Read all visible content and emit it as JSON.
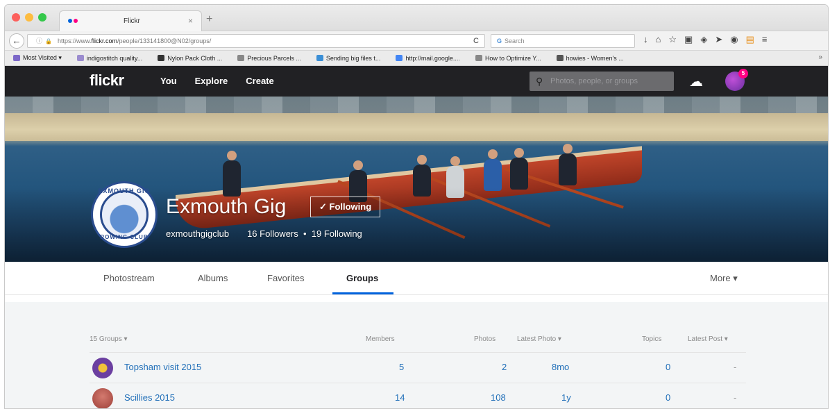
{
  "browser": {
    "tab_title": "Flickr",
    "tab_close": "×",
    "new_tab": "+",
    "back_icon": "←",
    "url_info_icon": "ⓘ",
    "url_lock_icon": "🔒",
    "url_prefix": "https://www.",
    "url_host": "flickr.com",
    "url_path": "/people/133141800@N02/groups/",
    "reload_icon": "C",
    "search_placeholder": "Search",
    "search_g": "G",
    "toolbar_icons": [
      "↓",
      "⌂",
      "☆",
      "▣",
      "◈",
      "➤",
      "◉",
      "▤",
      "≡"
    ],
    "bookmarks": [
      {
        "label": "Most Visited ▾",
        "color": "#7c68c8"
      },
      {
        "label": "indigostitch quality...",
        "color": "#9b8ccf"
      },
      {
        "label": "Nylon Pack Cloth ...",
        "color": "#333333"
      },
      {
        "label": "Precious Parcels ...",
        "color": "#888888"
      },
      {
        "label": "Sending big files t...",
        "color": "#3b8fd6"
      },
      {
        "label": "http://mail.google....",
        "color": "#4285f4"
      },
      {
        "label": "How to Optimize Y...",
        "color": "#888888"
      },
      {
        "label": "howies - Women's ...",
        "color": "#555555"
      }
    ],
    "bookmarks_overflow": "»"
  },
  "flickr": {
    "logo": "flickr",
    "nav": [
      "You",
      "Explore",
      "Create"
    ],
    "search_placeholder": "Photos, people, or groups",
    "search_icon": "⚲",
    "upload_icon": "☁",
    "notification_count": "5"
  },
  "profile": {
    "name": "Exmouth Gig",
    "follow_label": "✓ Following",
    "username": "exmouthgigclub",
    "followers": "16 Followers",
    "separator": "•",
    "following": "19 Following",
    "logo_top": "EXMOUTH GIG",
    "logo_bottom": "ROWING CLUB"
  },
  "subnav": {
    "tabs": [
      "Photostream",
      "Albums",
      "Favorites",
      "Groups"
    ],
    "active": "Groups",
    "more": "More ▾"
  },
  "groups": {
    "headers": {
      "count": "15 Groups ▾",
      "members": "Members",
      "photos": "Photos",
      "latest_photo": "Latest Photo ▾",
      "topics": "Topics",
      "latest_post": "Latest Post ▾"
    },
    "rows": [
      {
        "name": "Topsham visit 2015",
        "members": "5",
        "photos": "2",
        "latest_photo": "8mo",
        "topics": "0",
        "latest_post": "-",
        "avatar_color": "#6b3fa0"
      },
      {
        "name": "Scillies 2015",
        "members": "14",
        "photos": "108",
        "latest_photo": "1y",
        "topics": "0",
        "latest_post": "-",
        "avatar_color": "#b5564f"
      }
    ]
  }
}
